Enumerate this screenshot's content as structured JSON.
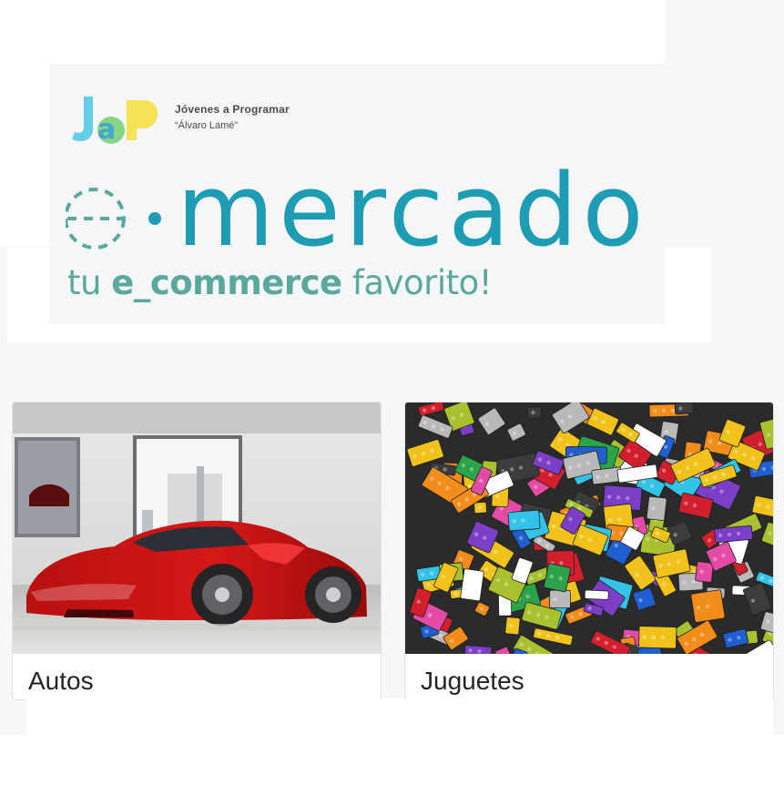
{
  "header": {
    "jap_line1": "Jóvenes a Programar",
    "jap_line2": "“Álvaro Lamé”",
    "brand_name": "mercado",
    "tagline_prefix": "tu ",
    "tagline_strong": "e_commerce",
    "tagline_suffix": " favorito!"
  },
  "categories": [
    {
      "title": "Autos",
      "image_icon": "red-sports-car-image"
    },
    {
      "title": "Juguetes",
      "image_icon": "lego-bricks-image"
    }
  ],
  "colors": {
    "brand": "#1e9cb4",
    "tagline": "#5aa89d"
  }
}
